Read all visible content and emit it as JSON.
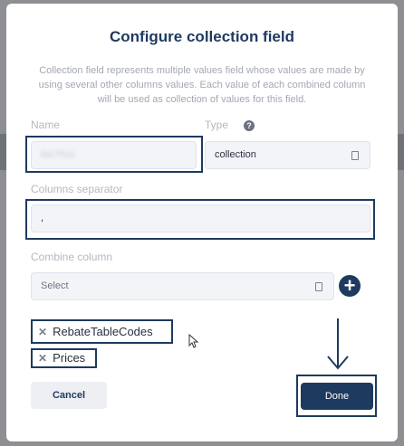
{
  "dialog": {
    "title": "Configure collection field",
    "description": "Collection field represents multiple values field whose values are made by using several other columns values. Each value of each combined column will be used as collection of values for this field."
  },
  "fields": {
    "name_label": "Name",
    "name_value": "list Plus",
    "type_label": "Type",
    "type_value": "collection",
    "separator_label": "Columns separator",
    "separator_value": ",",
    "combine_label": "Combine column",
    "combine_placeholder": "Select"
  },
  "chips": [
    {
      "label": "RebateTableCodes"
    },
    {
      "label": "Prices"
    }
  ],
  "buttons": {
    "cancel": "Cancel",
    "done": "Done"
  },
  "colors": {
    "accent": "#1e3a5f",
    "annotation": "#1e3a5f"
  },
  "icons": {
    "help": "question-circle-icon",
    "add": "plus-circle-icon",
    "remove": "close-icon",
    "annotation": "arrow-down-icon"
  }
}
